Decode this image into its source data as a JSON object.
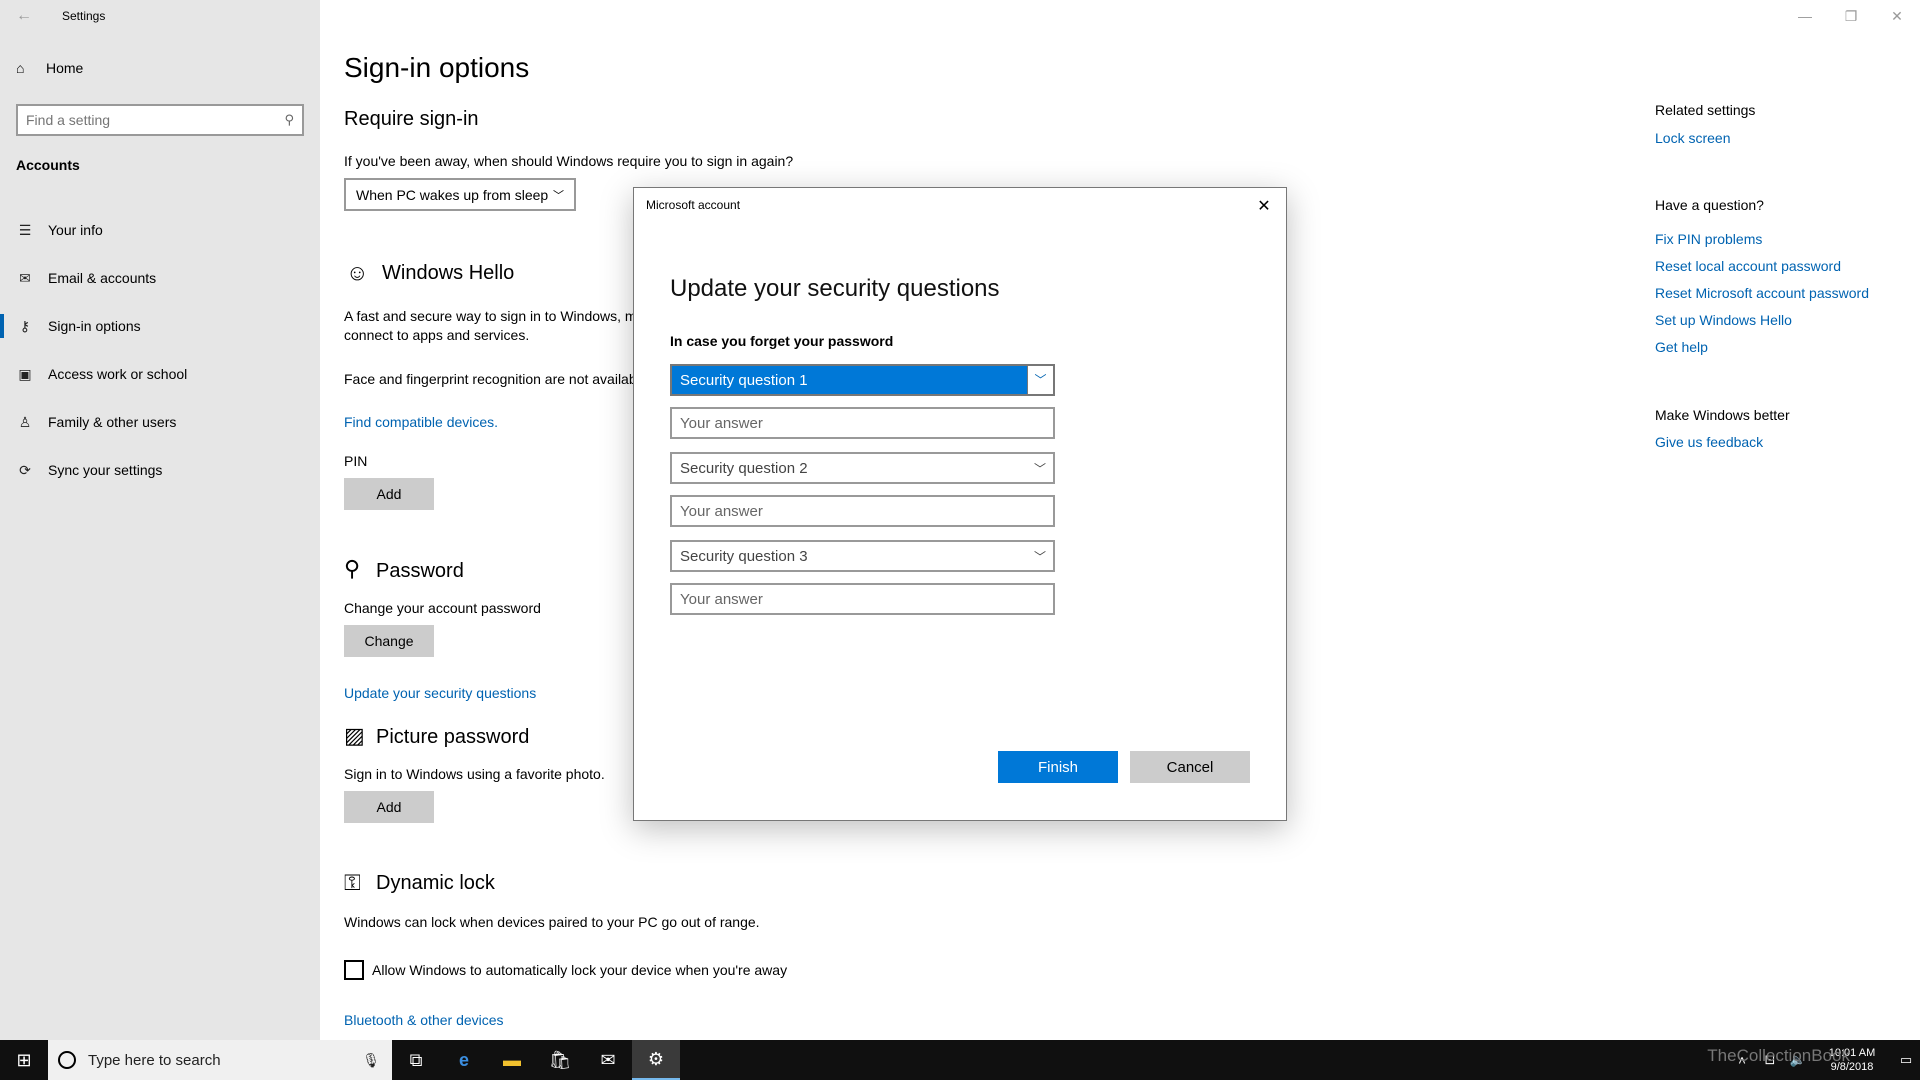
{
  "app": {
    "title": "Settings"
  },
  "window_controls": {
    "minimize": "—",
    "restore": "❐",
    "close": "✕"
  },
  "nav": {
    "home_label": "Home",
    "search_placeholder": "Find a setting",
    "section": "Accounts",
    "items": [
      {
        "label": "Your info",
        "icon": "person-icon"
      },
      {
        "label": "Email & accounts",
        "icon": "mail-icon"
      },
      {
        "label": "Sign-in options",
        "icon": "key-icon",
        "selected": true
      },
      {
        "label": "Access work or school",
        "icon": "briefcase-icon"
      },
      {
        "label": "Family & other users",
        "icon": "people-icon"
      },
      {
        "label": "Sync your settings",
        "icon": "sync-icon"
      }
    ]
  },
  "main": {
    "title": "Sign-in options",
    "require": {
      "heading": "Require sign-in",
      "question": "If you've been away, when should Windows require you to sign in again?",
      "dropdown_value": "When PC wakes up from sleep"
    },
    "hello": {
      "heading": "Windows Hello",
      "desc_line1": "A fast and secure way to sign in to Windows, m",
      "desc_line2": "connect to apps and services.",
      "note": "Face and fingerprint recognition are not availab",
      "link": "Find compatible devices.",
      "pin_label": "PIN",
      "pin_button": "Add"
    },
    "password": {
      "heading": "Password",
      "desc": "Change your account password",
      "button": "Change",
      "link": "Update your security questions"
    },
    "picture": {
      "heading": "Picture password",
      "desc": "Sign in to Windows using a favorite photo.",
      "button": "Add"
    },
    "dynamic": {
      "heading": "Dynamic lock",
      "desc": "Windows can lock when devices paired to your PC go out of range.",
      "checkbox_label": "Allow Windows to automatically lock your device when you're away",
      "checked": false,
      "link": "Bluetooth & other devices"
    }
  },
  "related": {
    "related_heading": "Related settings",
    "related_links": [
      "Lock screen"
    ],
    "question_heading": "Have a question?",
    "question_links": [
      "Fix PIN problems",
      "Reset local account password",
      "Reset Microsoft account password",
      "Set up Windows Hello",
      "Get help"
    ],
    "better_heading": "Make Windows better",
    "better_links": [
      "Give us feedback"
    ]
  },
  "dialog": {
    "title": "Microsoft account",
    "heading": "Update your security questions",
    "subheading": "In case you forget your password",
    "questions": [
      "Security question 1",
      "Security question 2",
      "Security question 3"
    ],
    "answer_placeholder": "Your answer",
    "finish": "Finish",
    "cancel": "Cancel"
  },
  "taskbar": {
    "search_placeholder": "Type here to search",
    "time": "10:01 AM",
    "date": "9/8/2018",
    "watermark": "TheCollectionBook"
  },
  "colors": {
    "accent": "#0078d7",
    "link": "#0063b1",
    "nav_bg": "#e6e6e6",
    "taskbar_bg": "#101010"
  }
}
